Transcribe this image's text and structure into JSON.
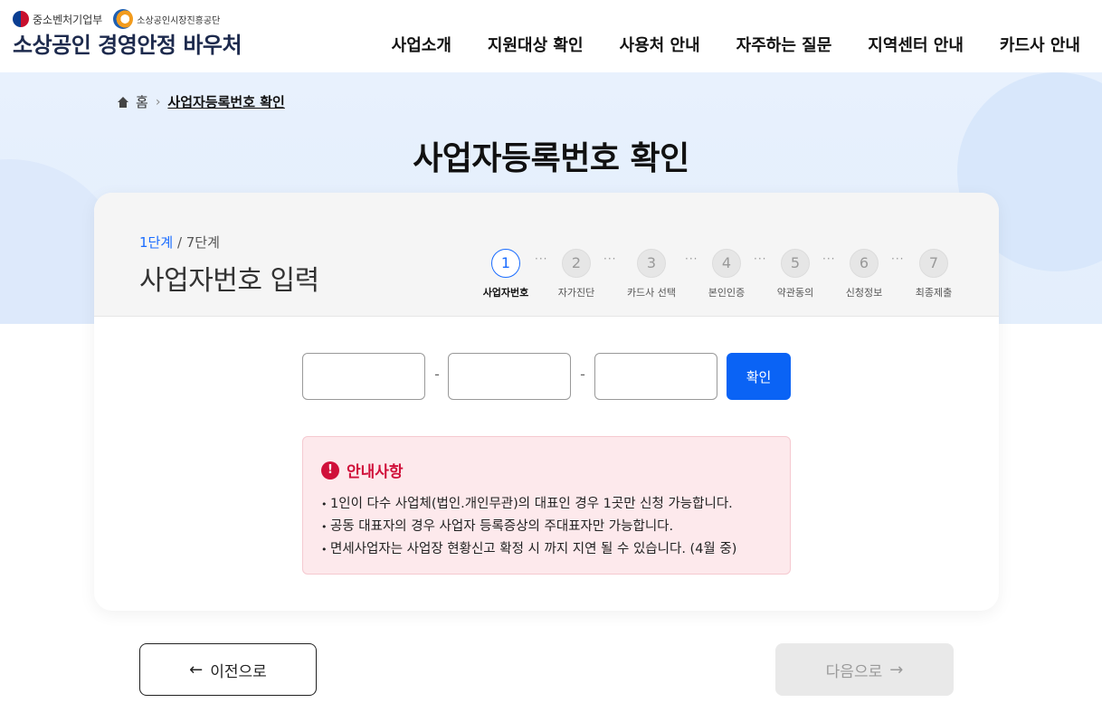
{
  "header": {
    "gov_org": "중소벤처기업부",
    "agency": "소상공인시장진흥공단",
    "site_title": "소상공인 경영안정 바우처",
    "nav": [
      "사업소개",
      "지원대상 확인",
      "사용처 안내",
      "자주하는 질문",
      "지역센터 안내",
      "카드사 안내"
    ]
  },
  "breadcrumb": {
    "home": "홈",
    "current": "사업자등록번호 확인"
  },
  "page_title": "사업자등록번호 확인",
  "step": {
    "current": "1단계",
    "total": "/ 7단계",
    "title": "사업자번호 입력"
  },
  "stepper": [
    {
      "num": "1",
      "label": "사업자번호",
      "active": true
    },
    {
      "num": "2",
      "label": "자가진단"
    },
    {
      "num": "3",
      "label": "카드사 선택"
    },
    {
      "num": "4",
      "label": "본인인증"
    },
    {
      "num": "5",
      "label": "약관동의"
    },
    {
      "num": "6",
      "label": "신청정보"
    },
    {
      "num": "7",
      "label": "최종제출"
    }
  ],
  "form": {
    "field1": "",
    "field2": "",
    "field3": "",
    "separator": "-",
    "confirm_label": "확인"
  },
  "notice": {
    "title": "안내사항",
    "items": [
      "1인이 다수 사업체(법인.개인무관)의 대표인 경우 1곳만 신청 가능합니다.",
      "공동 대표자의 경우 사업자 등록증상의 주대표자만 가능합니다.",
      "면세사업자는 사업장 현황신고 확정 시 까지 지연 될 수 있습니다. (4월 중)"
    ]
  },
  "nav_buttons": {
    "prev": "이전으로",
    "next": "다음으로"
  },
  "colors": {
    "primary": "#0a63f5",
    "alert": "#d0103a",
    "band": "#e8f1fd"
  }
}
